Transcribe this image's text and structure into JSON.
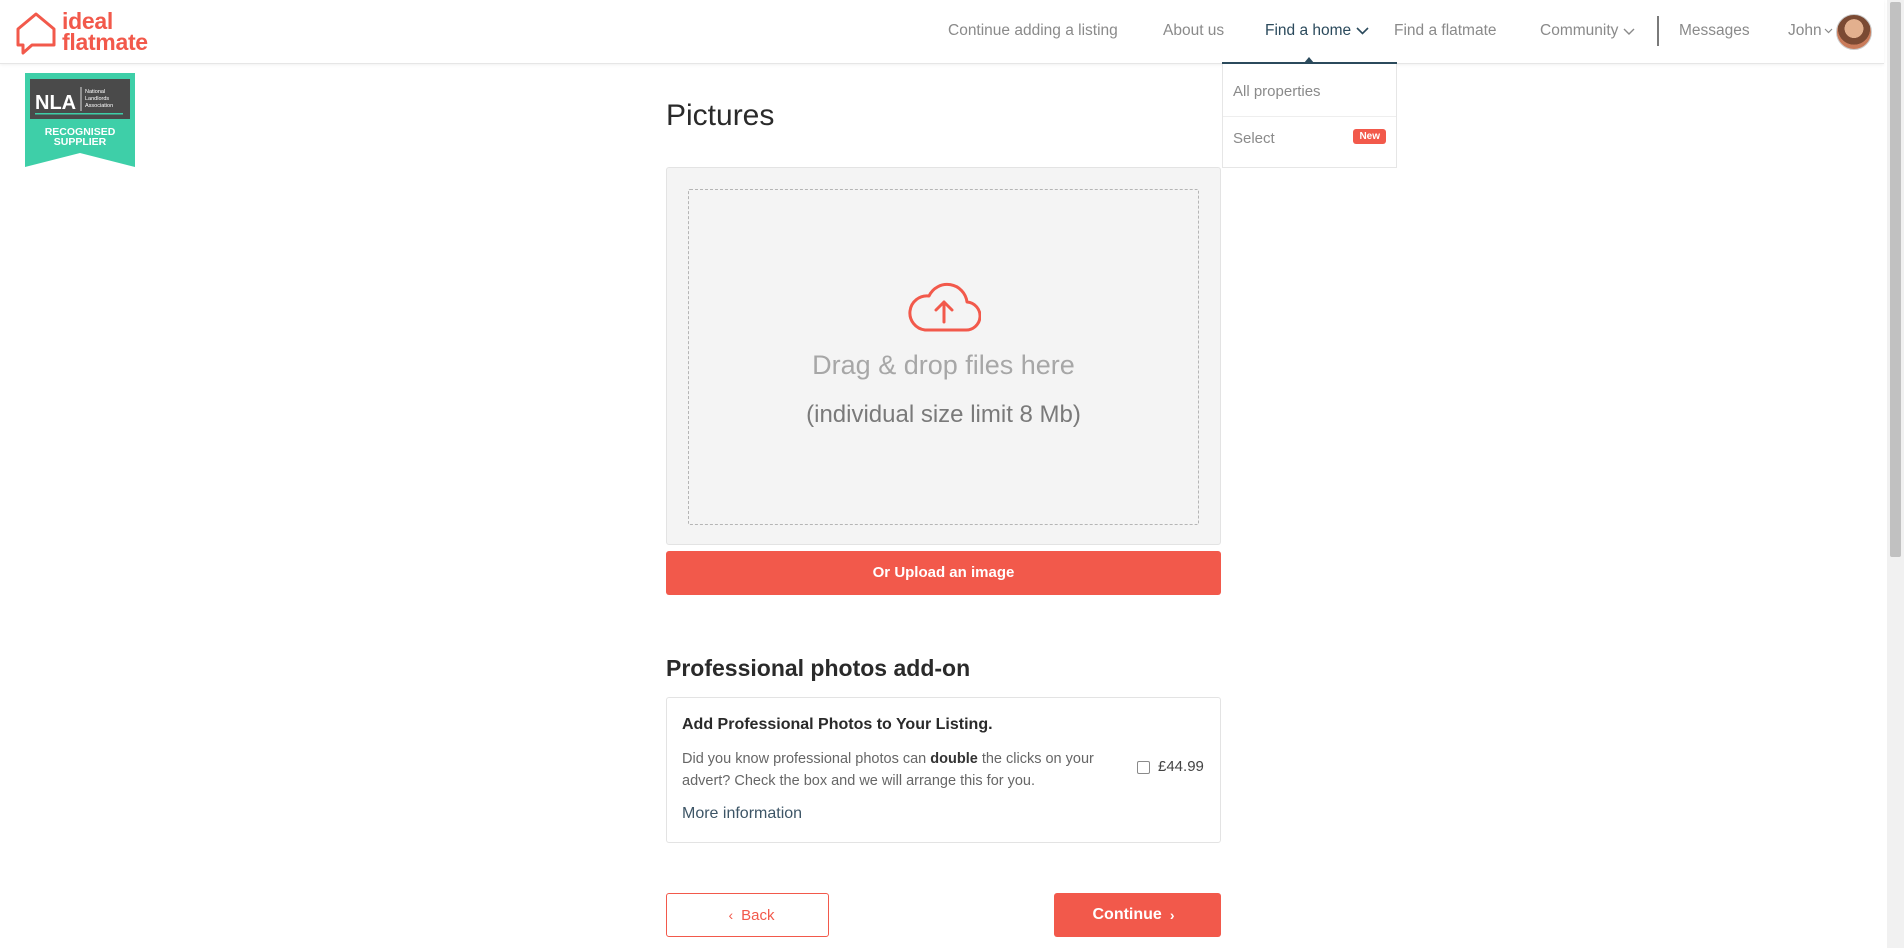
{
  "brand": {
    "line1": "ideal",
    "line2": "flatmate",
    "color": "#f2594b"
  },
  "nav": {
    "items": [
      {
        "label": "Continue adding a listing"
      },
      {
        "label": "About us"
      },
      {
        "label": "Find a home"
      },
      {
        "label": "Find a flatmate"
      },
      {
        "label": "Community"
      },
      {
        "label": "Messages"
      },
      {
        "label": "John"
      }
    ],
    "active": "Find a home"
  },
  "dropdown": {
    "items": [
      {
        "label": "All properties"
      },
      {
        "label": "Select",
        "badge": "New"
      }
    ]
  },
  "nla_badge": {
    "abbr": "NLA",
    "org": "National Landlords Association",
    "line1": "RECOGNISED",
    "line2": "SUPPLIER"
  },
  "page": {
    "title": "Pictures",
    "dropzone": {
      "text": "Drag & drop files here",
      "subtext": "(individual size limit 8 Mb)",
      "icon": "cloud-upload-icon"
    },
    "upload_button": "Or Upload an image",
    "addon": {
      "heading": "Professional photos add-on",
      "title": "Add Professional Photos to Your Listing.",
      "desc_before": "Did you know professional photos can ",
      "desc_bold": "double",
      "desc_after": " the clicks on your advert? Check the box and we will arrange this for you.",
      "price": "£44.99",
      "checked": false,
      "link": "More information"
    },
    "back_button": "Back",
    "continue_button": "Continue"
  },
  "colors": {
    "accent": "#f2594b",
    "nav_active": "#2b4a5c",
    "nla_green": "#3ecfa8",
    "nla_dark": "#4a4a4a"
  }
}
